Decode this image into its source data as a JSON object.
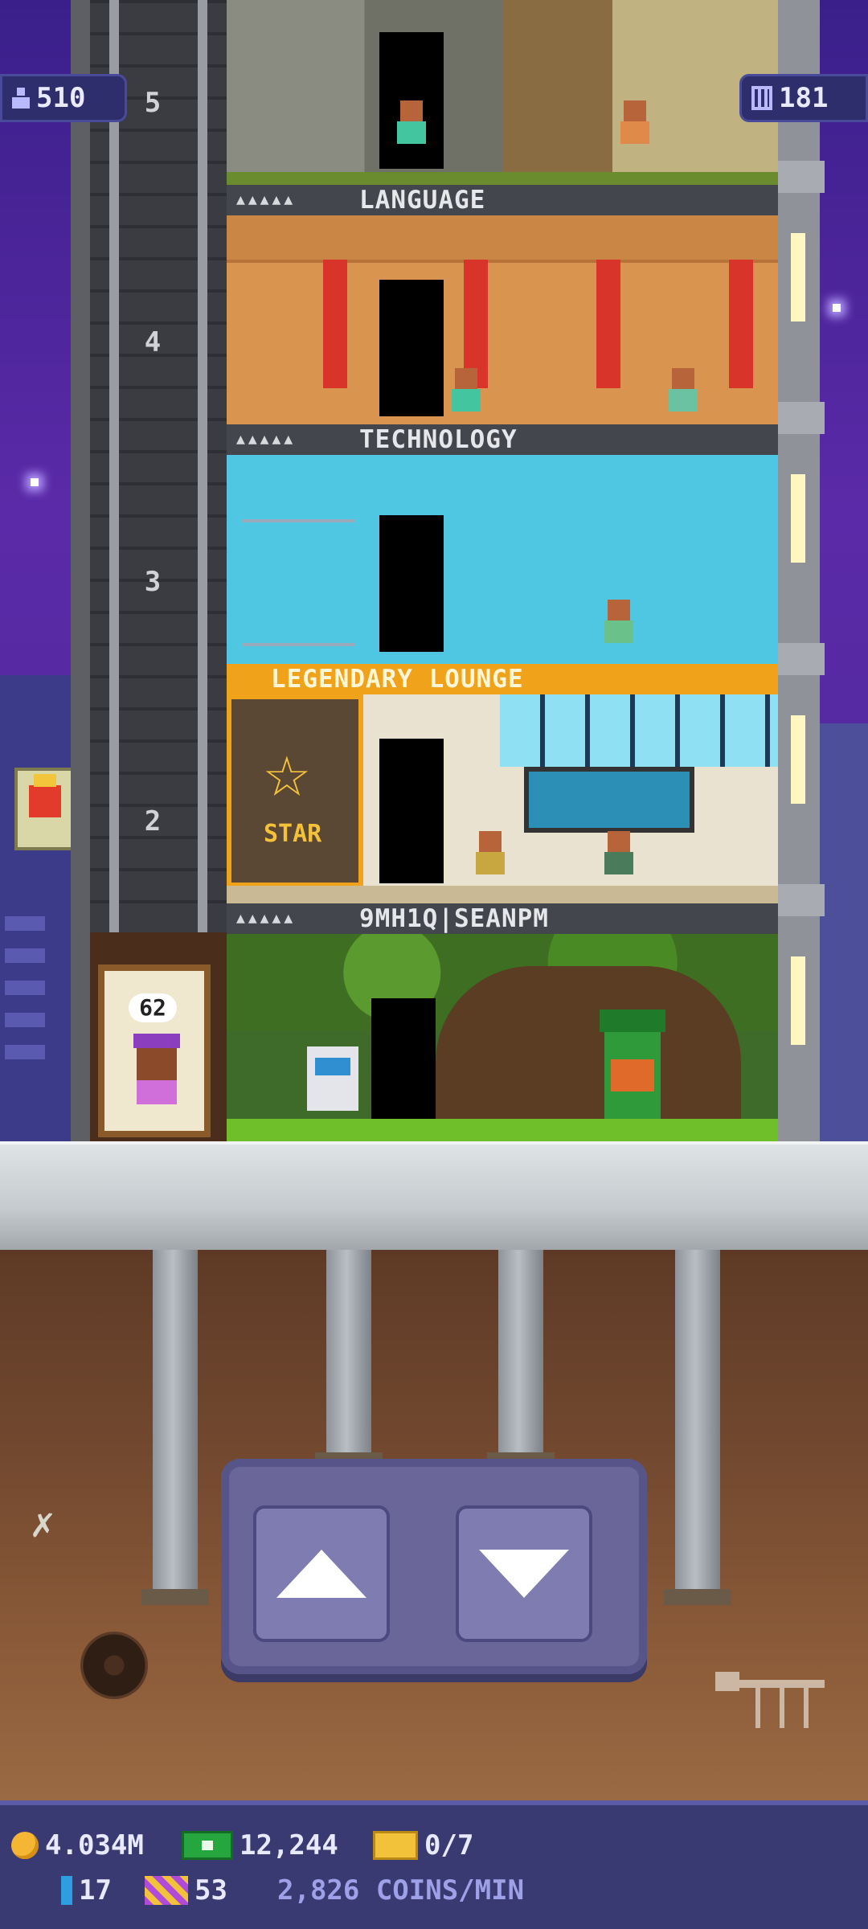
{
  "header": {
    "population": "510",
    "floors": "181"
  },
  "tower": {
    "floor_numbers": [
      "5",
      "4",
      "3",
      "2"
    ],
    "floors": [
      {
        "name": "LANGUAGE",
        "stars": "▲▲▲▲▲"
      },
      {
        "name": "TECHNOLOGY",
        "stars": "▲▲▲▲▲"
      },
      {
        "name": "LEGENDARY LOUNGE"
      },
      {
        "name": "9MH1Q|SEANPM",
        "stars": "▲▲▲▲▲"
      }
    ],
    "elevator_count": "62",
    "star_sign": "STAR"
  },
  "controls": {
    "up_label": "up-arrow",
    "down_label": "down-arrow"
  },
  "currency": {
    "coins": "4.034M",
    "bux": "12,244",
    "tickets": "0/7",
    "keys": "17",
    "legendary": "53",
    "rate": "2,826 COINS/MIN"
  }
}
